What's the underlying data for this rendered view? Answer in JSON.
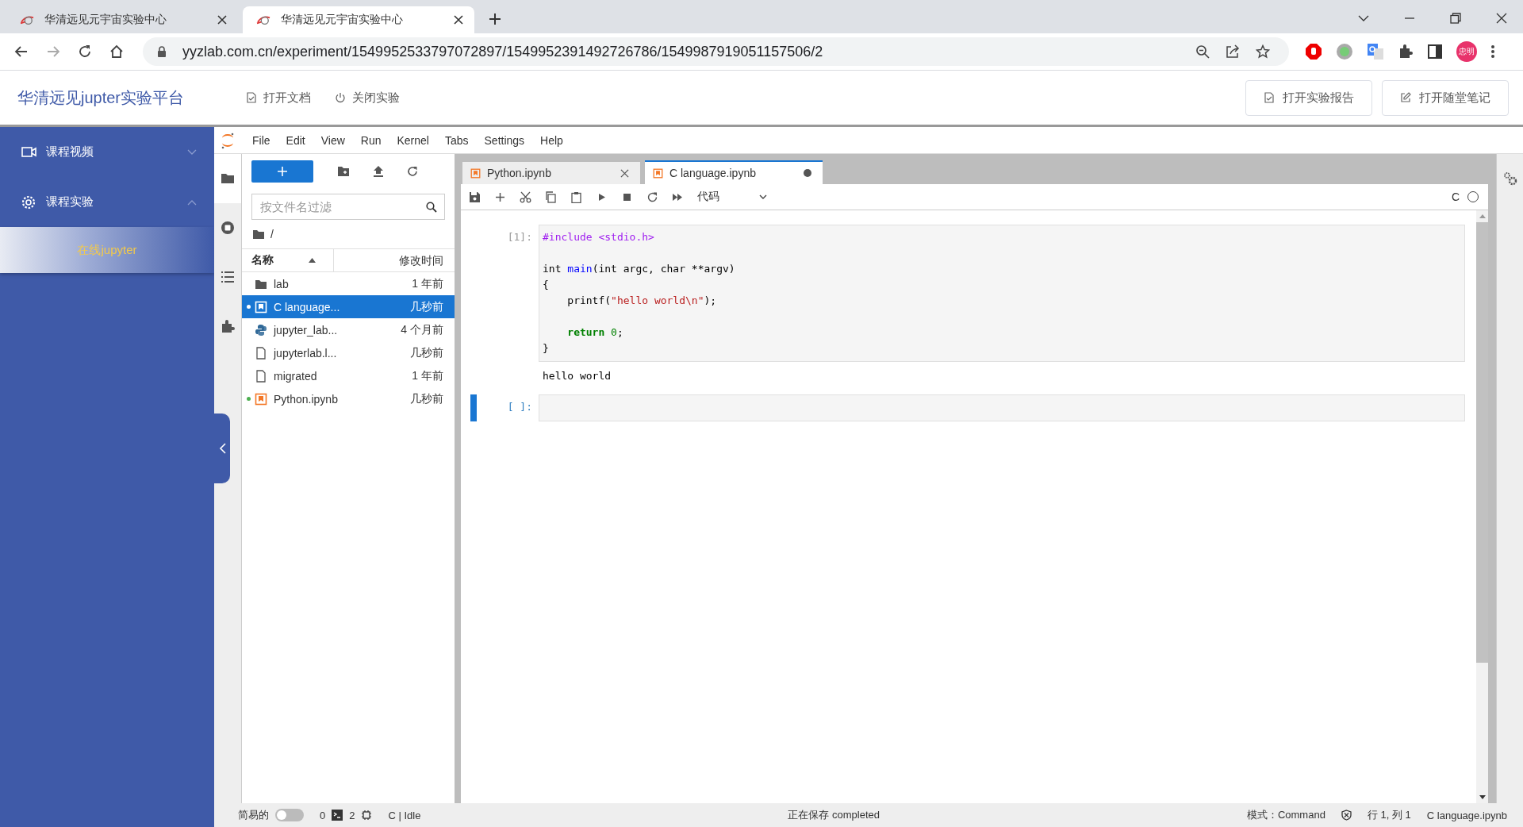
{
  "browser": {
    "tabs": [
      {
        "title": "华清远见元宇宙实验中心",
        "selected": false
      },
      {
        "title": "华清远见元宇宙实验中心",
        "selected": true
      }
    ],
    "url": "yyzlab.com.cn/experiment/1549952533797072897/1549952391492726786/1549987919051157506/2",
    "profile": "忠明"
  },
  "header": {
    "title": "华清远见jupter实验平台",
    "links": [
      {
        "label": "打开文档",
        "kind": "doc"
      },
      {
        "label": "关闭实验",
        "kind": "power"
      }
    ],
    "buttons": [
      {
        "label": "打开实验报告",
        "kind": "report"
      },
      {
        "label": "打开随堂笔记",
        "kind": "note"
      }
    ]
  },
  "sidebar": {
    "items": [
      {
        "label": "课程视频",
        "kind": "video",
        "expanded": false
      },
      {
        "label": "课程实验",
        "kind": "gear",
        "expanded": true,
        "children": [
          {
            "label": "在线jupyter",
            "selected": true
          }
        ]
      }
    ]
  },
  "jupyter": {
    "menu": [
      "File",
      "Edit",
      "View",
      "Run",
      "Kernel",
      "Tabs",
      "Settings",
      "Help"
    ],
    "file_browser": {
      "filter_placeholder": "按文件名过滤",
      "path": "/",
      "columns": [
        "名称",
        "修改时间"
      ],
      "rows": [
        {
          "kind": "folder",
          "name": "lab",
          "modified": "1 年前",
          "selected": false,
          "running": false
        },
        {
          "kind": "notebook",
          "name": "C language...",
          "modified": "几秒前",
          "selected": true,
          "running": true
        },
        {
          "kind": "python",
          "name": "jupyter_lab...",
          "modified": "4 个月前",
          "selected": false,
          "running": false
        },
        {
          "kind": "file",
          "name": "jupyterlab.l...",
          "modified": "几秒前",
          "selected": false,
          "running": false
        },
        {
          "kind": "file",
          "name": "migrated",
          "modified": "1 年前",
          "selected": false,
          "running": false
        },
        {
          "kind": "notebook",
          "name": "Python.ipynb",
          "modified": "几秒前",
          "selected": false,
          "running": true
        }
      ]
    },
    "notebook": {
      "tabs": [
        {
          "title": "Python.ipynb",
          "selected": false,
          "dirty": false
        },
        {
          "title": "C language.ipynb",
          "selected": true,
          "dirty": true
        }
      ],
      "cell_type": "代码",
      "kernel_name": "C",
      "kernel_idle": true,
      "cells": [
        {
          "prompt": "[1]:",
          "active": false,
          "output": "hello world",
          "tokens": [
            {
              "kind": "meta",
              "text": "#include <stdio.h>"
            },
            {
              "kind": "plain",
              "text": "\n\nint "
            },
            {
              "kind": "def",
              "text": "main"
            },
            {
              "kind": "plain",
              "text": "(int argc, char **argv)\n{\n    printf("
            },
            {
              "kind": "string",
              "text": "\"hello world\\n\""
            },
            {
              "kind": "plain",
              "text": ");\n\n    "
            },
            {
              "kind": "keyword",
              "text": "return"
            },
            {
              "kind": "number",
              "text": " 0"
            },
            {
              "kind": "plain",
              "text": ";\n}"
            }
          ]
        },
        {
          "prompt": "[ ]:",
          "active": true
        }
      ]
    }
  },
  "status_bar": {
    "simple_label": "简易的",
    "simple_on": false,
    "terminals": "0",
    "kernels": "2",
    "kernel_status": "C | Idle",
    "message": "正在保存 completed",
    "mode": "模式：Command",
    "position": "行 1, 列 1",
    "file": "C language.ipynb"
  }
}
